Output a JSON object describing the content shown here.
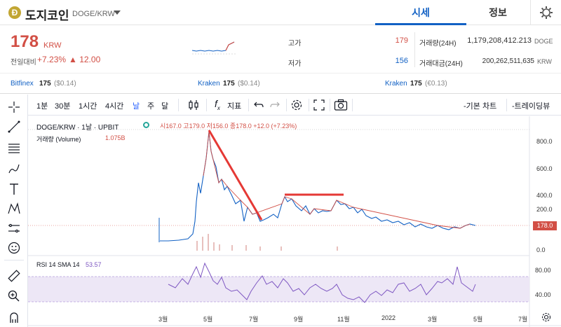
{
  "header": {
    "logo": "Ð",
    "coin_name": "도지코인",
    "pair": "DOGE/KRW",
    "tabs": {
      "price": "시세",
      "info": "정보"
    }
  },
  "ticker": {
    "price": "178",
    "unit": "KRW",
    "vs_label": "전일대비",
    "change_pct": "+7.23%",
    "change_amt": "▲ 12.00",
    "high_label": "고가",
    "high": "179",
    "low_label": "저가",
    "low": "156",
    "volume_label": "거래량(24H)",
    "volume": "1,179,208,412.213",
    "volume_unit": "DOGE",
    "value_label": "거래대금(24H)",
    "value": "200,262,511,635",
    "value_unit": "KRW"
  },
  "exchanges": [
    {
      "name": "Bitfinex",
      "price": "175",
      "alt": "($0.14)"
    },
    {
      "name": "Kraken",
      "price": "175",
      "alt": "($0.14)"
    },
    {
      "name": "Kraken",
      "price": "175",
      "alt": "(€0.13)"
    }
  ],
  "toolbar": {
    "intervals": [
      "1분",
      "30분",
      "1시간",
      "4시간",
      "날",
      "주",
      "달"
    ],
    "indicators": "지표",
    "basic_chart": "-기본 차트",
    "tradingview": "-트레이딩뷰"
  },
  "chart": {
    "title": "DOGE/KRW · 1날 · UPBIT",
    "ohlc": "시167.0 고179.0 저156.0 종178.0 +12.0 (+7.23%)",
    "volume_label": "거래량 (Volume)",
    "volume_value": "1.075B",
    "rsi_label": "RSI 14 SMA 14",
    "rsi_value": "53.57",
    "price_tag": "178.0",
    "price_axis": [
      "800.0",
      "600.0",
      "400.0",
      "200.0",
      "0.0"
    ],
    "rsi_axis": [
      "80.00",
      "40.00"
    ],
    "x_axis": [
      "3월",
      "5월",
      "7월",
      "9월",
      "11월",
      "2022",
      "3월",
      "5월",
      "7월"
    ],
    "accent_up": "#d24f45",
    "accent_down": "#1261c4"
  }
}
